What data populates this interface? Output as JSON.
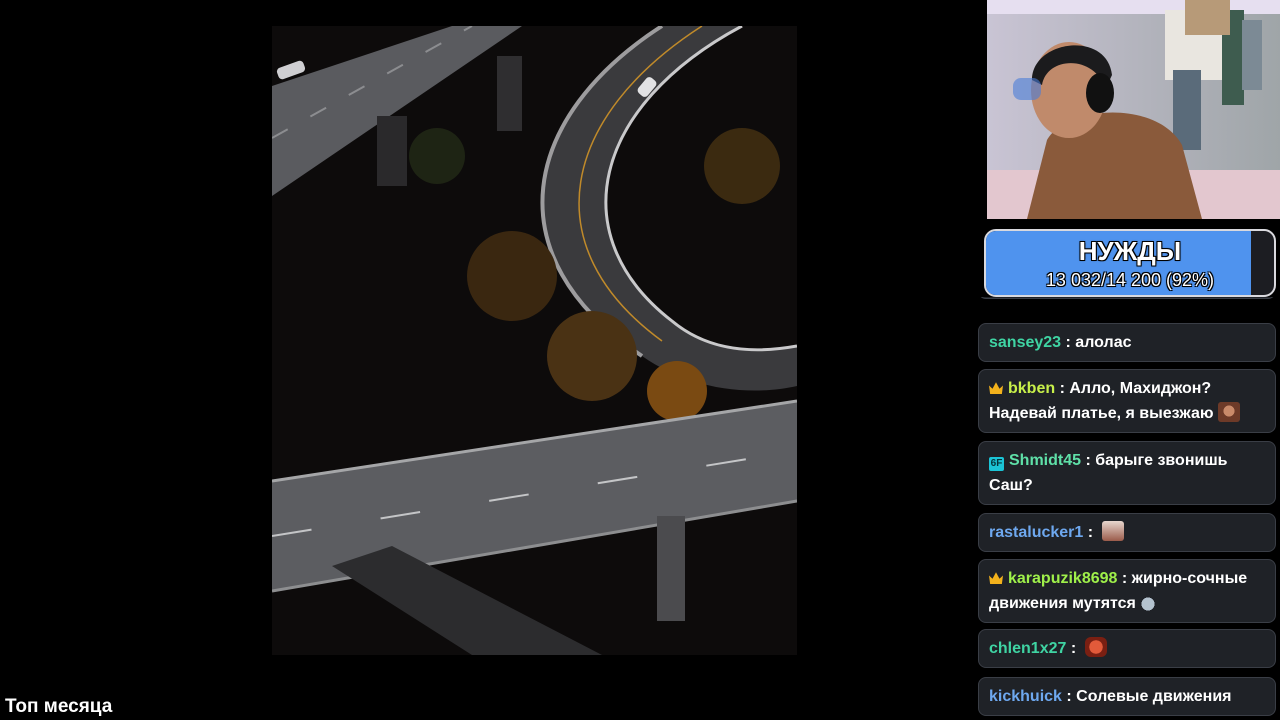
{
  "goal": {
    "title": "НУЖДЫ",
    "progress_text": "13 032/14 200 (92%)",
    "progress_fraction": 0.92,
    "fill_color": "#4f93ee"
  },
  "bottom_caption": "Топ месяца",
  "chat": {
    "messages": [
      {
        "username": "sansey23",
        "name_color": "#3fd4a3",
        "text": "алолас",
        "badge": null,
        "emote": null
      },
      {
        "username": "bkben",
        "name_color": "#c8f04a",
        "text": "Алло, Махиджон? Надевай платье, я выезжаю",
        "badge": "crown",
        "emote": "emote-face"
      },
      {
        "username": "Shmidt45",
        "name_color": "#5fe0a8",
        "text": "барыге звонишь Саш?",
        "badge": "6f",
        "emote": null
      },
      {
        "username": "rastalucker1",
        "name_color": "#6ea8ef",
        "text": "",
        "badge": null,
        "emote": "emote-cat"
      },
      {
        "username": "karapuzik8698",
        "name_color": "#9ff04a",
        "text": "жирно-сочные движения мутятся",
        "badge": "crown",
        "emote": "emote-rabbit"
      },
      {
        "username": "chlen1x27",
        "name_color": "#3fd4a3",
        "text": "",
        "badge": null,
        "emote": "emote-mask"
      },
      {
        "username": "kickhuick",
        "name_color": "#6ea8ef",
        "text": "Солевые движения",
        "badge": null,
        "emote": null
      }
    ]
  }
}
